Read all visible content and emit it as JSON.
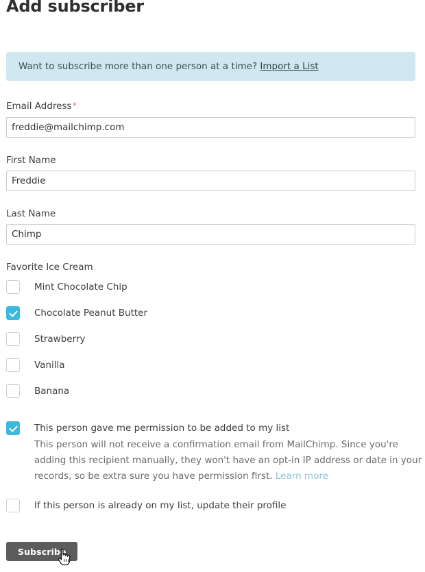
{
  "page": {
    "title": "Add subscriber"
  },
  "banner": {
    "text": "Want to subscribe more than one person at a time? ",
    "link_label": "Import a List",
    "background_color": "#cfe8ef"
  },
  "form": {
    "fields": [
      {
        "label": "Email Address",
        "required": true,
        "required_marker": "*",
        "value": "freddie@mailchimp.com",
        "placeholder": ""
      },
      {
        "label": "First Name",
        "required": false,
        "required_marker": "",
        "value": "Freddie",
        "placeholder": ""
      },
      {
        "label": "Last Name",
        "required": false,
        "required_marker": "",
        "value": "Chimp",
        "placeholder": ""
      }
    ]
  },
  "ice_cream_group": {
    "label": "Favorite Ice Cream",
    "options": [
      {
        "label": "Mint Chocolate Chip",
        "checked": false
      },
      {
        "label": "Chocolate Peanut Butter",
        "checked": true
      },
      {
        "label": "Strawberry",
        "checked": false
      },
      {
        "label": "Vanilla",
        "checked": false
      },
      {
        "label": "Banana",
        "checked": false
      }
    ]
  },
  "permission": {
    "label": "This person gave me permission to be added to my list",
    "checked": true,
    "description": "This person will not receive a confirmation email from MailChimp. Since you're adding this recipient manually, they won't have an opt-in IP address or date in your records, so be extra sure you have permission first. ",
    "learn_more_label": "Learn more"
  },
  "update_profile": {
    "label": "If this person is already on my list, update their profile",
    "checked": false
  },
  "submit": {
    "label": "Subscribe",
    "background_color": "#5c5c5c"
  },
  "colors": {
    "accent": "#3cb9dc",
    "required_star": "#e8796f",
    "link": "#90c4d4",
    "text": "#3d3d3d",
    "muted_text": "#6b6b6b",
    "input_border": "#cccccc"
  },
  "cursor": {
    "icon": "pointing-hand-cursor"
  }
}
